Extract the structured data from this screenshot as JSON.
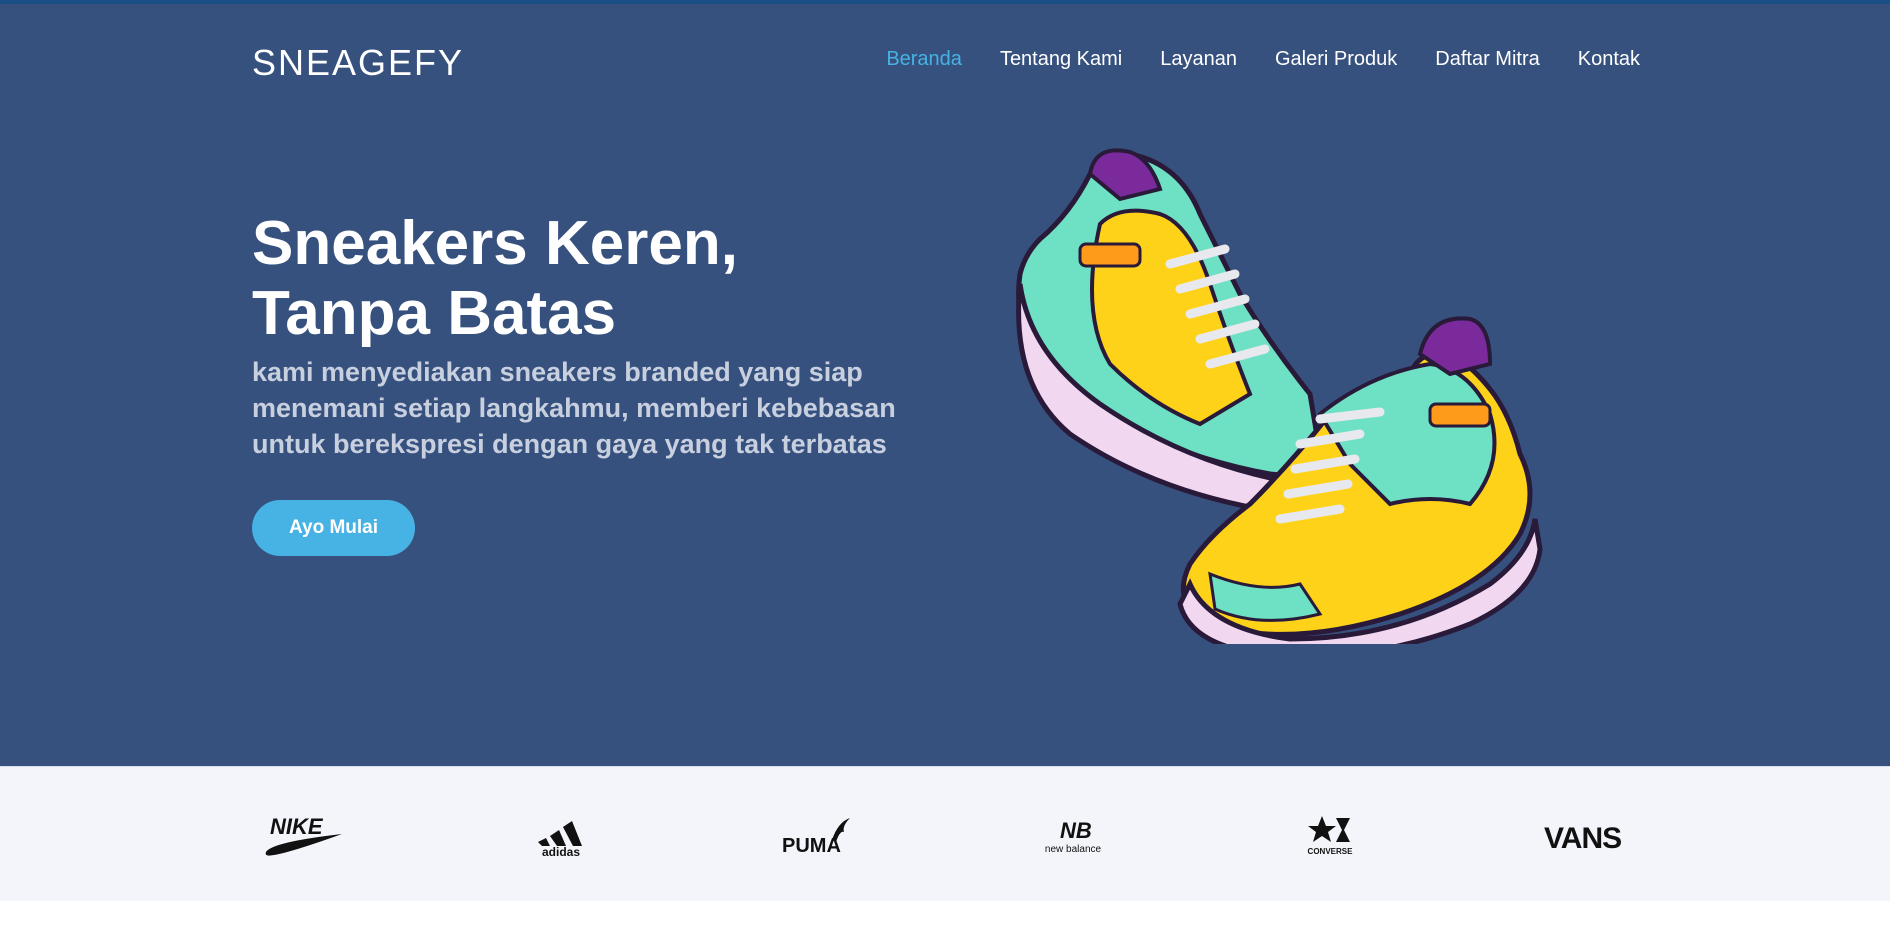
{
  "header": {
    "logo": "SNEAGEFY",
    "nav": [
      {
        "label": "Beranda",
        "active": true
      },
      {
        "label": "Tentang Kami",
        "active": false
      },
      {
        "label": "Layanan",
        "active": false
      },
      {
        "label": "Galeri Produk",
        "active": false
      },
      {
        "label": "Daftar Mitra",
        "active": false
      },
      {
        "label": "Kontak",
        "active": false
      }
    ]
  },
  "hero": {
    "headline": "Sneakers Keren, Tanpa Batas",
    "subtitle": "kami menyediakan sneakers branded yang siap menemani setiap langkahmu, memberi kebebasan untuk berekspresi dengan gaya yang tak terbatas",
    "cta_label": "Ayo Mulai",
    "illustration": "sneakers-illustration"
  },
  "brands": [
    {
      "name": "NIKE",
      "icon": "nike-logo"
    },
    {
      "name": "adidas",
      "icon": "adidas-logo"
    },
    {
      "name": "PUMA",
      "icon": "puma-logo"
    },
    {
      "name": "new balance",
      "icon": "new-balance-logo"
    },
    {
      "name": "CONVERSE",
      "icon": "converse-logo"
    },
    {
      "name": "VANS",
      "icon": "vans-logo"
    }
  ],
  "colors": {
    "hero_bg": "#37517e",
    "accent": "#47b2e4",
    "brands_bg": "#f3f5fa"
  }
}
